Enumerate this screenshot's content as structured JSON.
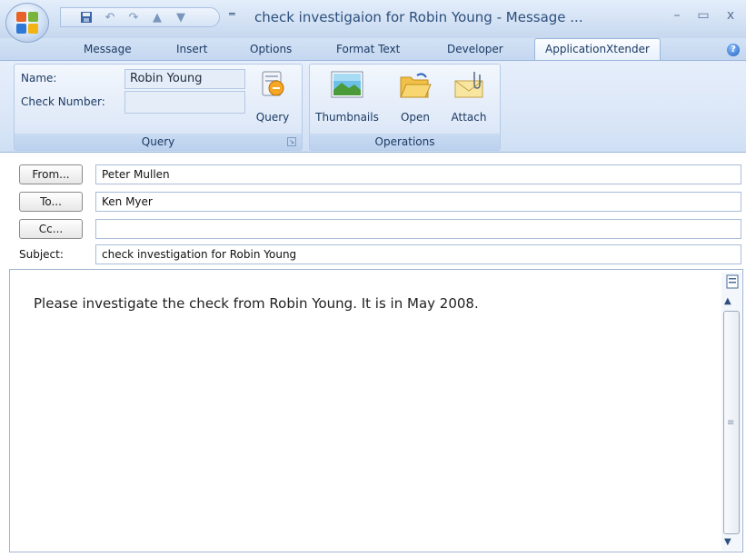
{
  "window": {
    "title": "check investigaion for Robin Young - Message ...",
    "qat_more": "═",
    "minimize": "–",
    "maximize": "▭",
    "close": "x"
  },
  "tabs": [
    {
      "label": "Message"
    },
    {
      "label": "Insert"
    },
    {
      "label": "Options"
    },
    {
      "label": "Format Text"
    },
    {
      "label": "Developer"
    },
    {
      "label": "ApplicationXtender"
    }
  ],
  "ribbon": {
    "query_group": {
      "name_label": "Name:",
      "name_value": "Robin Young",
      "check_number_label": "Check Number:",
      "check_number_value": "",
      "query_button": "Query",
      "group_label": "Query"
    },
    "operations_group": {
      "thumbnails_button": "Thumbnails",
      "open_button": "Open",
      "attach_button": "Attach",
      "group_label": "Operations"
    }
  },
  "header": {
    "from_button": "From...",
    "from_value": "Peter Mullen",
    "to_button": "To...",
    "to_value": "Ken Myer",
    "cc_button": "Cc...",
    "cc_value": "",
    "subject_label": "Subject:",
    "subject_value": "check investigation for Robin Young"
  },
  "body": {
    "text": "Please investigate the check from Robin Young. It is in May 2008."
  },
  "colors": {
    "ribbon_bg": "#dbe7f8",
    "active_tab": "#fbfdff",
    "title_text": "#2e4f7c"
  }
}
